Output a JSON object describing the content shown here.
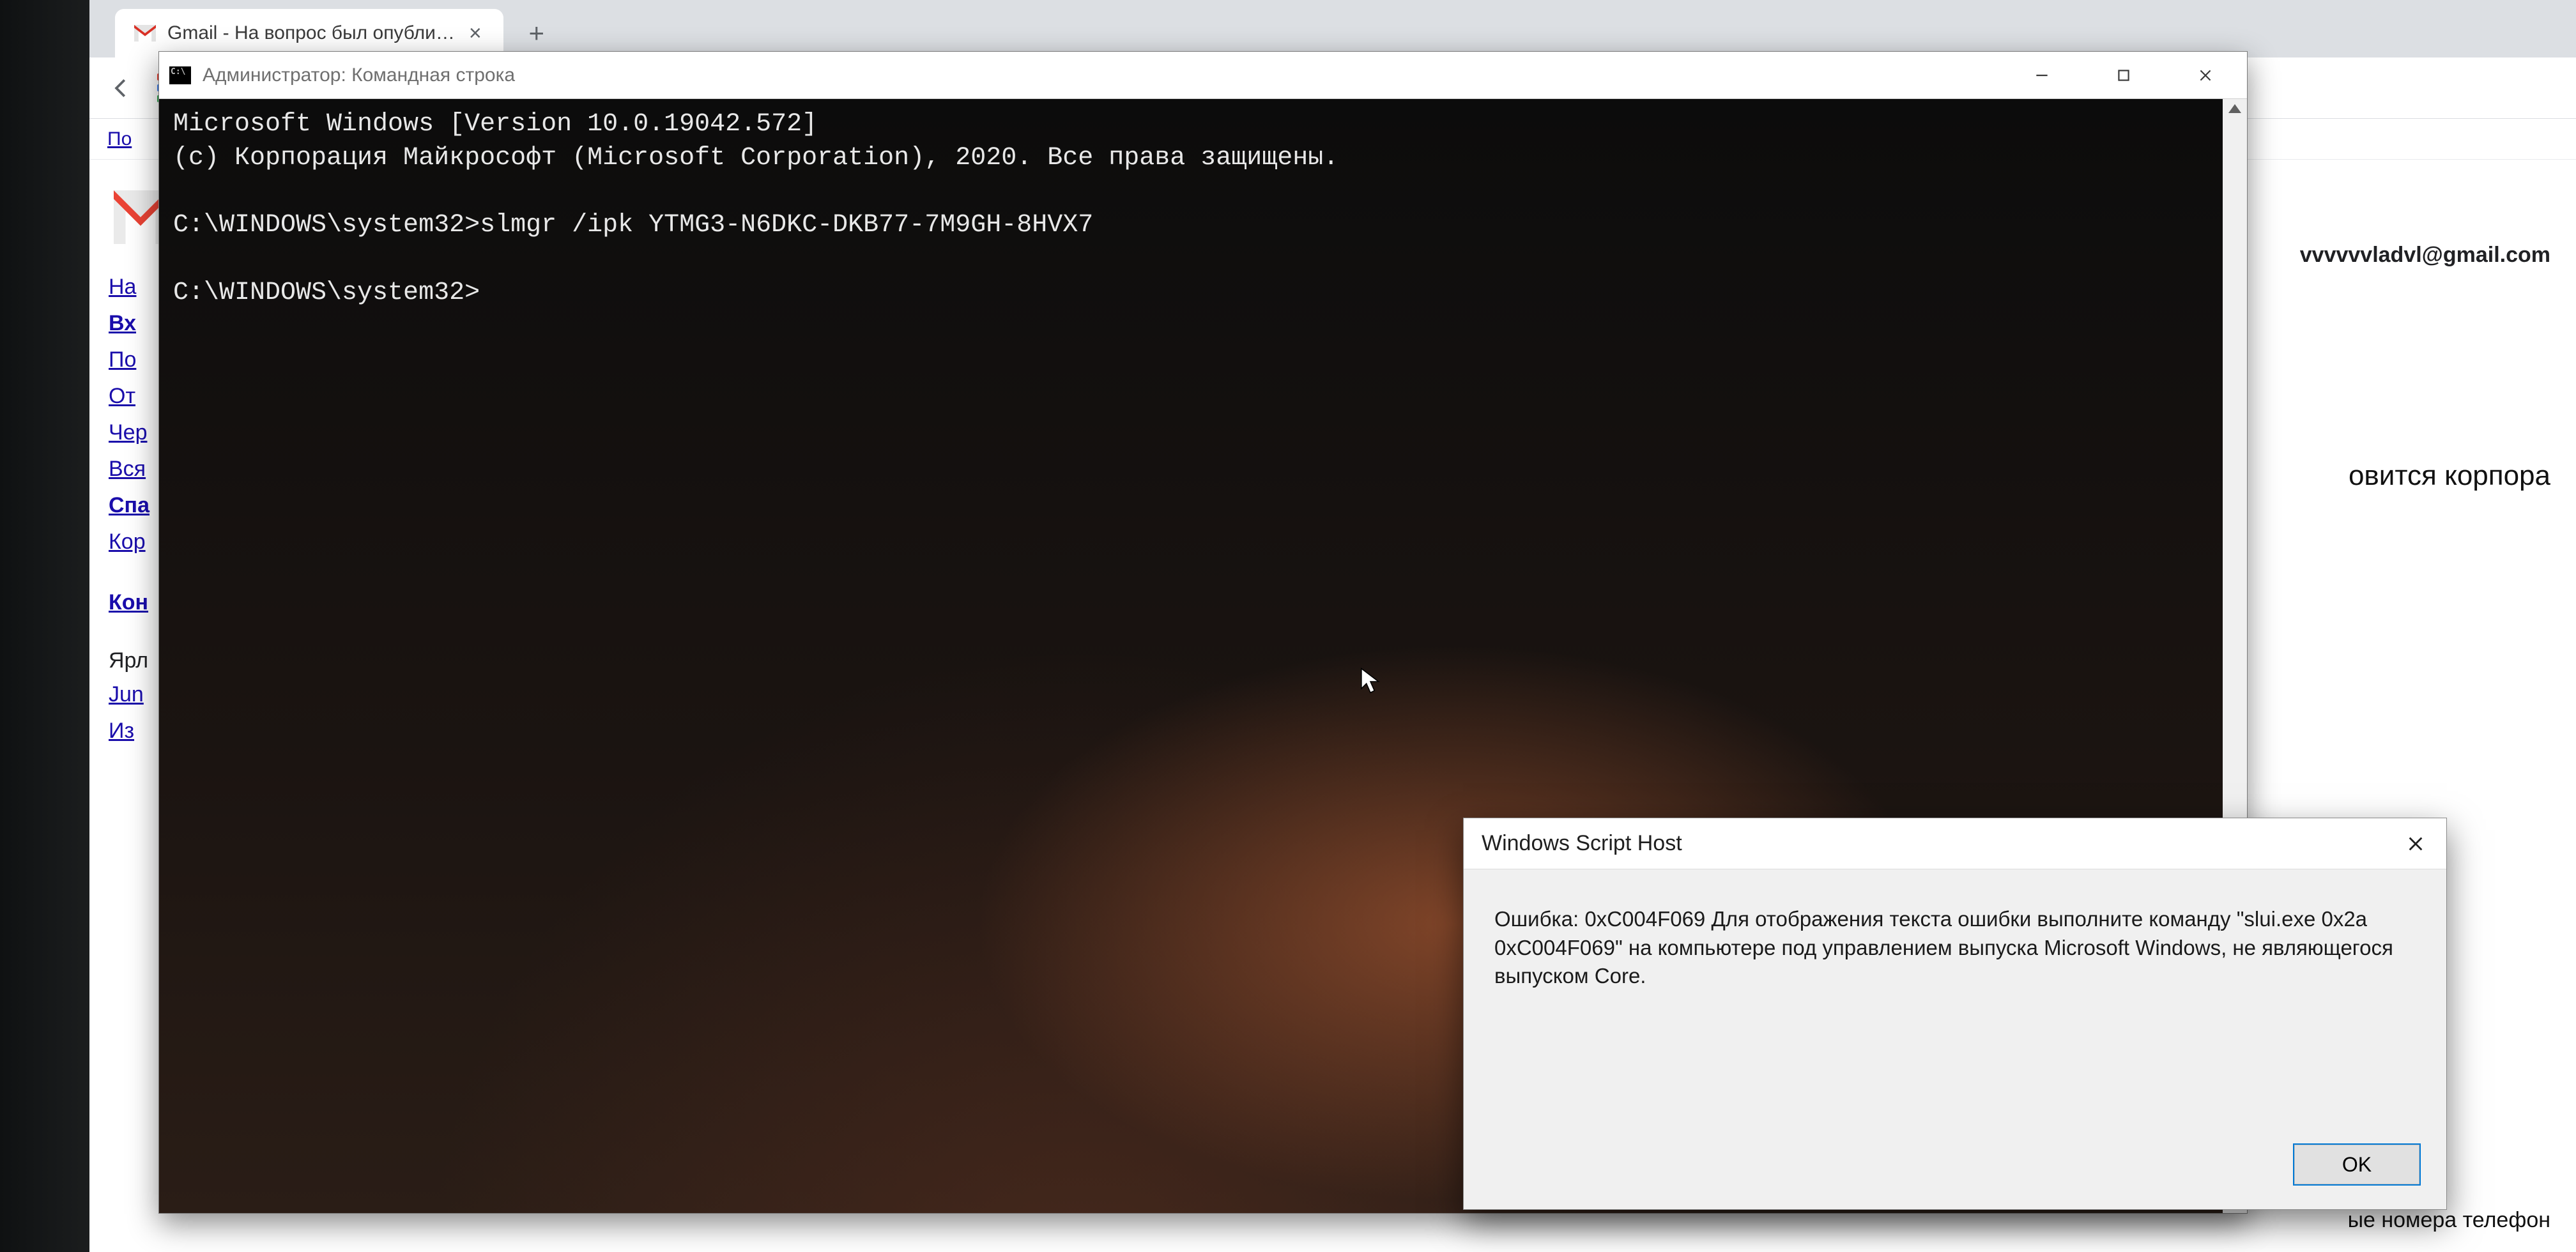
{
  "browser": {
    "tab_title": "Gmail - На вопрос был опубли…",
    "bookmark_link": "По",
    "account_email": "vvvvvvladvl@gmail.com",
    "headline_fragment": "овится корпора",
    "footer_fragment": "ые номера телефон",
    "sidebar": [
      {
        "label": "На",
        "bold": false
      },
      {
        "label": "Вх",
        "bold": true
      },
      {
        "label": "По",
        "bold": false
      },
      {
        "label": "От",
        "bold": false
      },
      {
        "label": "Чер",
        "bold": false
      },
      {
        "label": "Вся",
        "bold": false
      },
      {
        "label": "Спа",
        "bold": true
      },
      {
        "label": "Кор",
        "bold": false
      }
    ],
    "sidebar2": [
      {
        "label": "Кон",
        "bold": true
      }
    ],
    "sidebar3": [
      {
        "label": "Ярл",
        "plain": true
      },
      {
        "label": "Jun",
        "plain": false
      },
      {
        "label": "Из",
        "plain": false
      }
    ]
  },
  "cmd": {
    "title": "Администратор: Командная строка",
    "line1": "Microsoft Windows [Version 10.0.19042.572]",
    "line2": "(c) Корпорация Майкрософт (Microsoft Corporation), 2020. Все права защищены.",
    "line3": "",
    "line4": "C:\\WINDOWS\\system32>slmgr /ipk YTMG3-N6DKC-DKB77-7M9GH-8HVX7",
    "line5": "",
    "line6": "C:\\WINDOWS\\system32>"
  },
  "wsh": {
    "title": "Windows Script Host",
    "message": "Ошибка: 0xC004F069 Для отображения текста ошибки выполните команду \"slui.exe 0x2a 0xC004F069\" на компьютере под управлением выпуска Microsoft Windows, не являющегося выпуском Core.",
    "ok": "OK"
  }
}
